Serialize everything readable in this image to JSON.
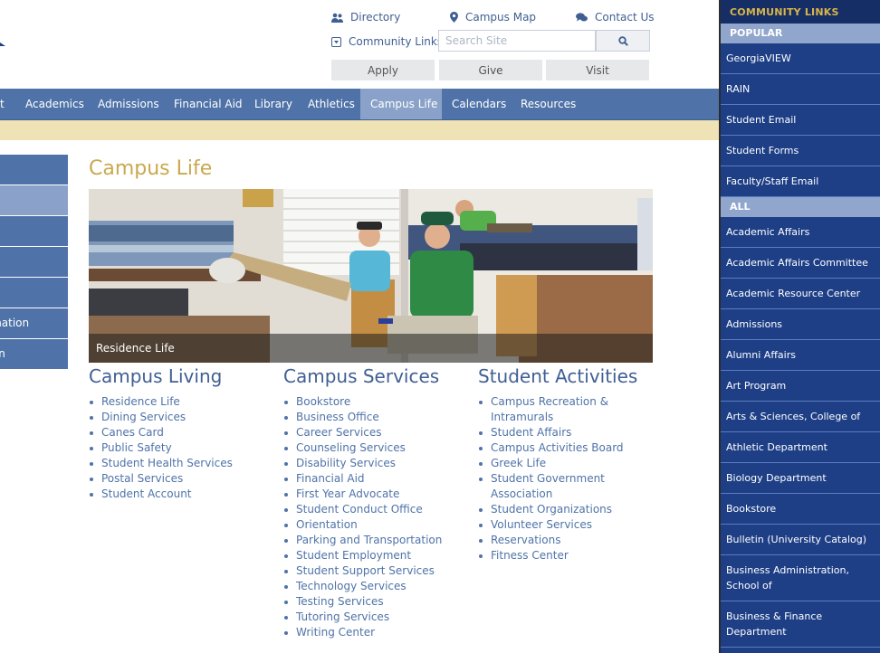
{
  "utility": {
    "directory": "Directory",
    "campus_map": "Campus Map",
    "contact_us": "Contact Us",
    "community_links": "Community Links",
    "search_placeholder": "Search Site",
    "apply": "Apply",
    "give": "Give",
    "visit": "Visit"
  },
  "nav": {
    "items": [
      "t",
      "Academics",
      "Admissions",
      "Financial Aid",
      "Library",
      "Athletics",
      "Campus Life",
      "Calendars",
      "Resources"
    ],
    "active": "Campus Life"
  },
  "left_nav": {
    "items": [
      "",
      "",
      "",
      "",
      "",
      "ormation",
      "ision"
    ]
  },
  "page_title": "Campus Life",
  "hero": {
    "caption": "Residence Life"
  },
  "columns": [
    {
      "heading": "Campus Living",
      "links": [
        "Residence Life",
        "Dining Services",
        "Canes Card",
        "Public Safety",
        "Student Health Services",
        "Postal Services",
        "Student Account"
      ]
    },
    {
      "heading": "Campus Services",
      "links": [
        "Bookstore",
        "Business Office",
        "Career Services",
        "Counseling Services",
        "Disability Services",
        "Financial Aid",
        "First Year Advocate",
        "Student Conduct Office",
        "Orientation",
        "Parking and Transportation",
        "Student Employment",
        "Student Support Services",
        "Technology Services",
        "Testing Services",
        "Tutoring Services",
        "Writing Center"
      ]
    },
    {
      "heading": "Student Activities",
      "links": [
        "Campus Recreation & Intramurals",
        "Student Affairs",
        "Campus Activities Board",
        "Greek Life",
        "Student Government Association",
        "Student Organizations",
        "Volunteer Services",
        "Reservations",
        "Fitness Center"
      ]
    }
  ],
  "community_links": {
    "title": "COMMUNITY LINKS",
    "popular_label": "POPULAR",
    "popular": [
      "GeorgiaVIEW",
      "RAIN",
      "Student Email",
      "Student Forms",
      "Faculty/Staff Email"
    ],
    "all_label": "ALL",
    "all": [
      "Academic Affairs",
      "Academic Affairs Committee",
      "Academic Resource Center",
      "Admissions",
      "Alumni Affairs",
      "Art Program",
      "Arts & Sciences, College of",
      "Athletic Department",
      "Biology Department",
      "Bookstore",
      "Bulletin (University Catalog)",
      "Business Administration, School of",
      "Business & Finance Department"
    ]
  }
}
